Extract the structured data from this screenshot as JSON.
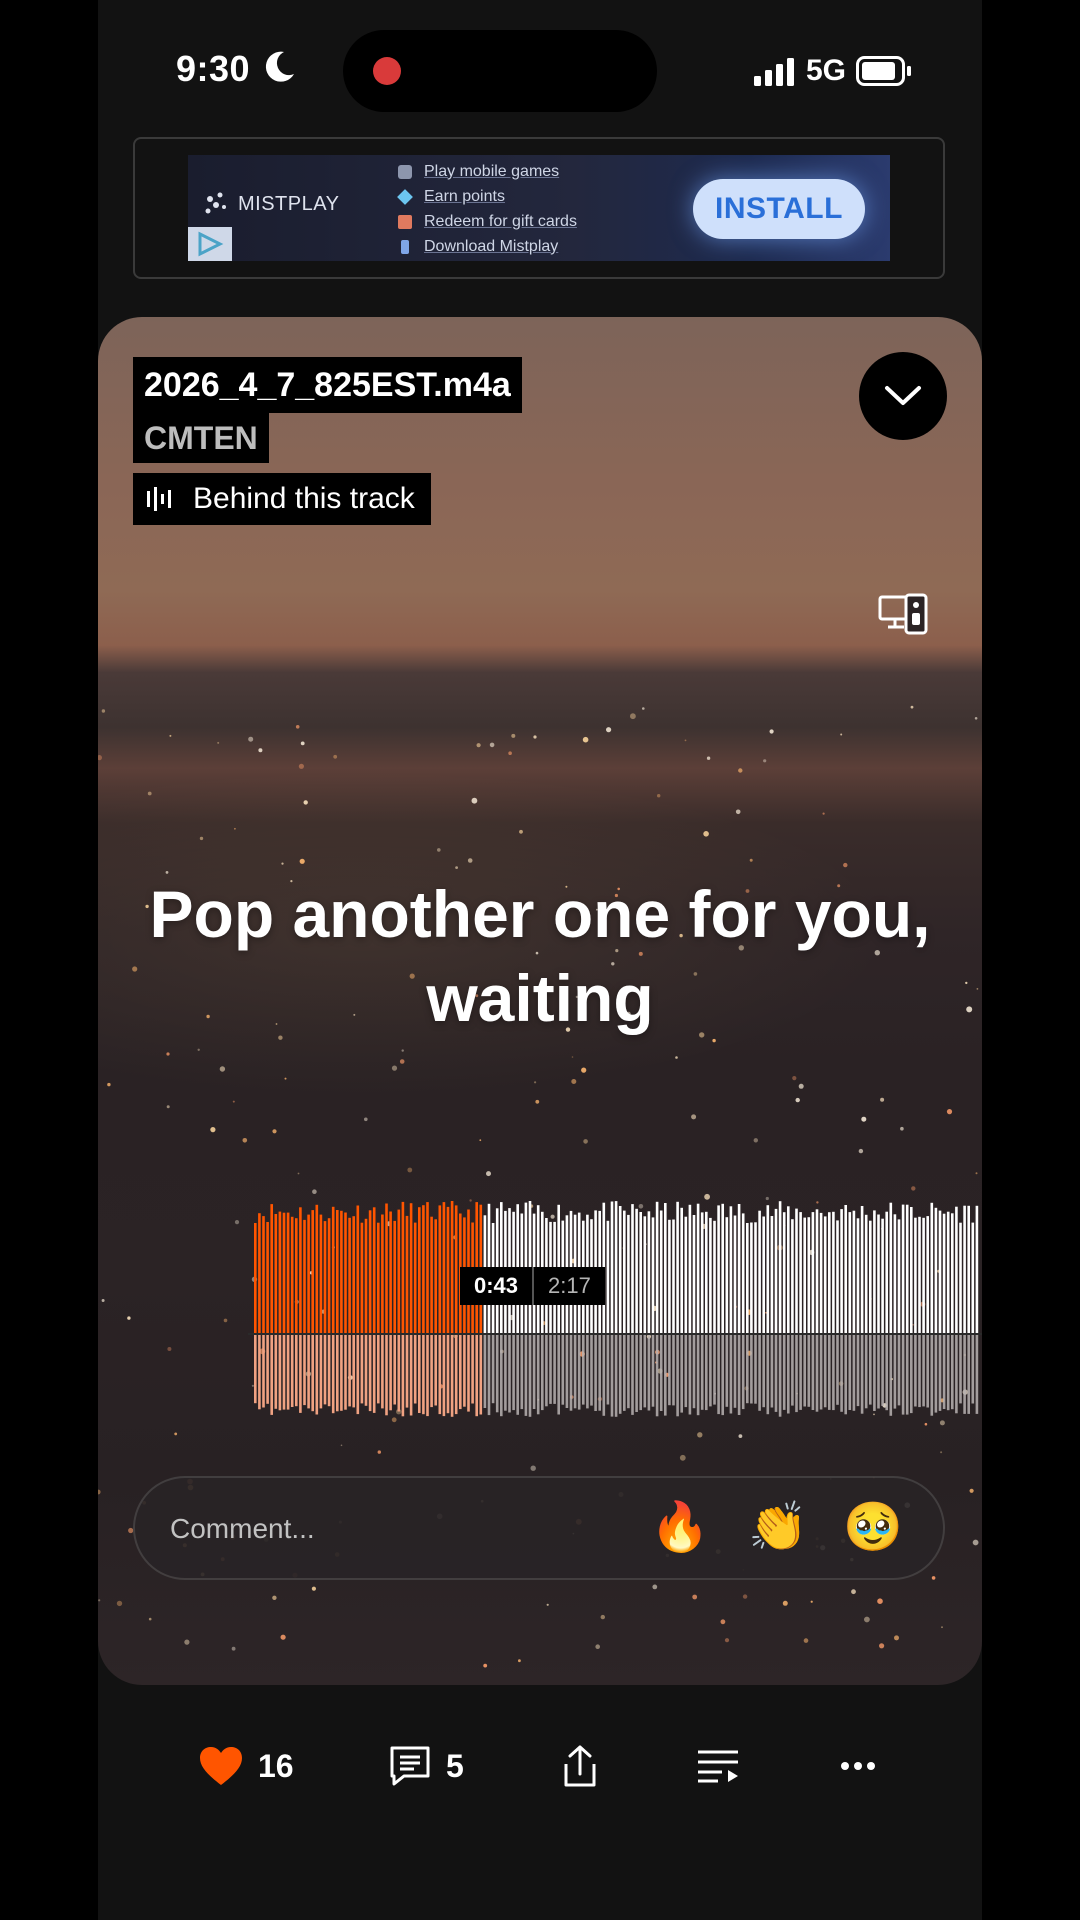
{
  "status_bar": {
    "time": "9:30",
    "network": "5G"
  },
  "ad": {
    "brand": "MISTPLAY",
    "features": [
      "Play mobile games",
      "Earn points",
      "Redeem for gift cards",
      "Download Mistplay"
    ],
    "install_label": "INSTALL"
  },
  "player": {
    "track_title": "2026_4_7_825EST.m4a",
    "artist": "CMTEN",
    "behind_track_label": "Behind this track",
    "lyric": "Pop another one for you, waiting",
    "current_time": "0:43",
    "total_time": "2:17",
    "progress": 0.314,
    "comment_placeholder": "Comment...",
    "reactions": [
      "🔥",
      "👏",
      "🥹"
    ]
  },
  "actions": {
    "likes": "16",
    "comments": "5"
  },
  "colors": {
    "accent": "#ff5500",
    "played_reflection": "#f0a282",
    "background": "#121212"
  }
}
